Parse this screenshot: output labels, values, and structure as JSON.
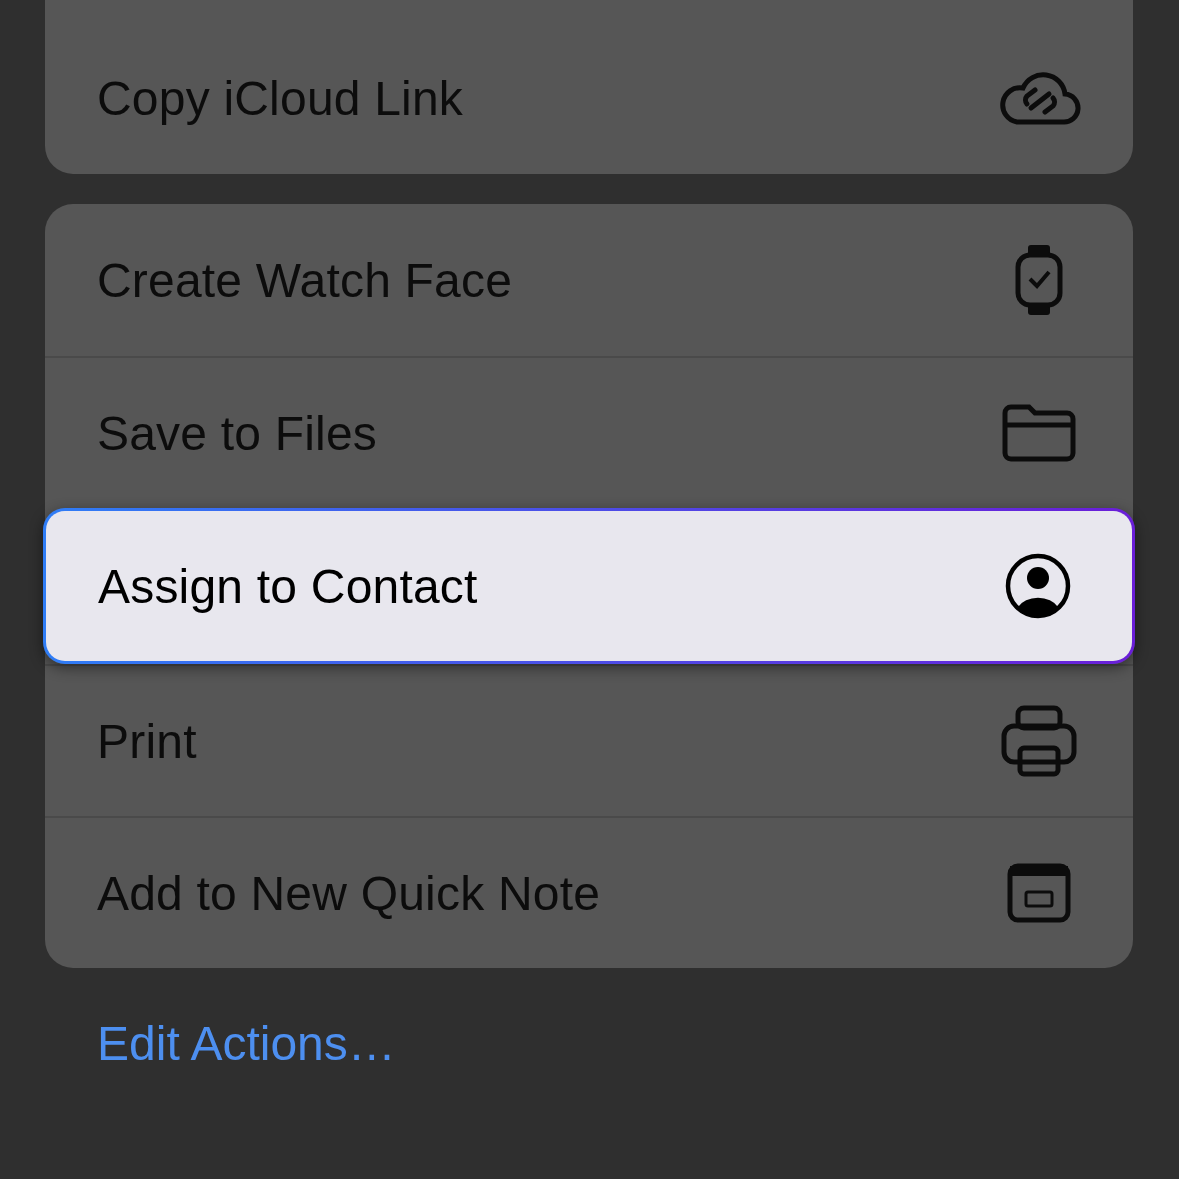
{
  "groups": [
    {
      "items": [
        {
          "label": "Copy iCloud Link",
          "selected": false
        }
      ]
    },
    {
      "items": [
        {
          "label": "Create Watch Face",
          "selected": false
        },
        {
          "label": "Save to Files",
          "selected": false
        },
        {
          "label": "Assign to Contact",
          "selected": true
        },
        {
          "label": "Print",
          "selected": false
        },
        {
          "label": "Add to New Quick Note",
          "selected": false
        }
      ]
    }
  ],
  "edit_link": "Edit Actions…"
}
